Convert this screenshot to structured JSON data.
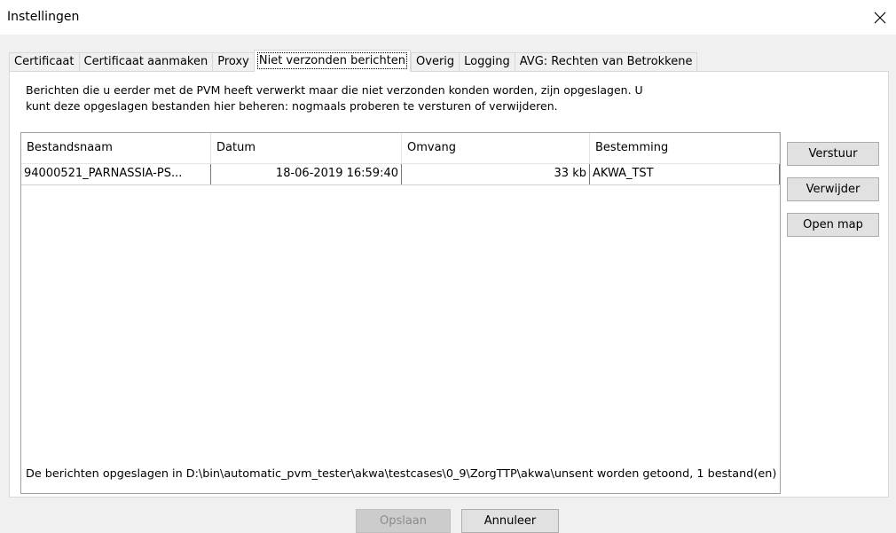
{
  "window": {
    "title": "Instellingen",
    "close_icon": "close-icon"
  },
  "tabs": [
    {
      "label": "Certificaat"
    },
    {
      "label": "Certificaat aanmaken"
    },
    {
      "label": "Proxy"
    },
    {
      "label": "Niet verzonden berichten",
      "active": true
    },
    {
      "label": "Overig"
    },
    {
      "label": "Logging"
    },
    {
      "label": "AVG: Rechten van Betrokkene"
    }
  ],
  "panel": {
    "description_line1": "Berichten die u eerder met de PVM heeft verwerkt maar die niet verzonden konden worden, zijn opgeslagen. U",
    "description_line2": "kunt deze opgeslagen bestanden hier beheren: nogmaals proberen te versturen of verwijderen.",
    "table": {
      "columns": [
        "Bestandsnaam",
        "Datum",
        "Omvang",
        "Bestemming"
      ],
      "rows": [
        {
          "bestandsnaam": "94000521_PARNASSIA-PS...",
          "datum": "18-06-2019 16:59:40",
          "omvang": "33 kb",
          "bestemming": "AKWA_TST"
        }
      ]
    },
    "buttons": {
      "verstuur": "Verstuur",
      "verwijder": "Verwijder",
      "open_map": "Open map"
    },
    "status": "De berichten opgeslagen in D:\\bin\\automatic_pvm_tester\\akwa\\testcases\\0_9\\ZorgTTP\\akwa\\unsent worden getoond, 1 bestand(en)"
  },
  "footer": {
    "save_label": "Opslaan",
    "cancel_label": "Annuleer"
  }
}
